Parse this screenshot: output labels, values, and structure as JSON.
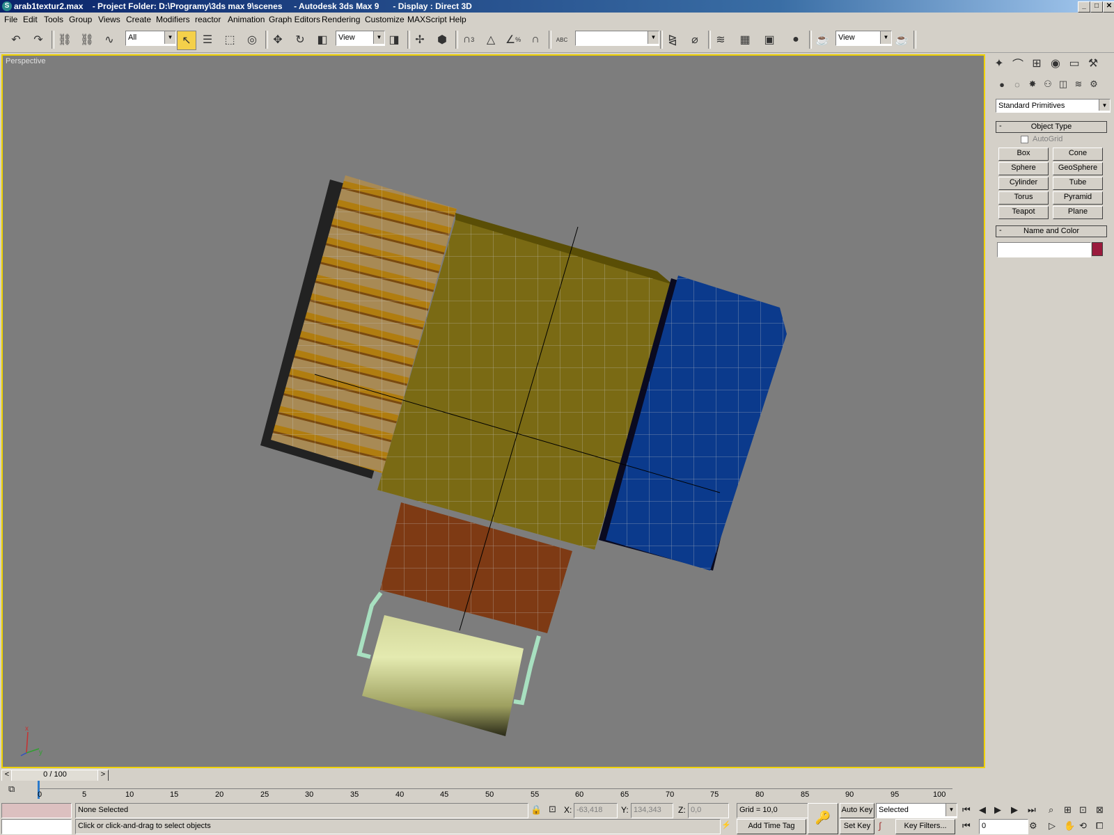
{
  "window": {
    "title": "arab1textur2.max    - Project Folder: D:\\Programy\\3ds max 9\\scenes     - Autodesk 3ds Max 9      - Display : Direct 3D",
    "logo": "S",
    "min": "_",
    "max": "□",
    "close": "✕"
  },
  "menu": [
    "File",
    "Edit",
    "Tools",
    "Group",
    "Views",
    "Create",
    "Modifiers",
    "reactor",
    "Animation",
    "Graph Editors",
    "Rendering",
    "Customize",
    "MAXScript",
    "Help"
  ],
  "toolbar": {
    "selection_filter": "All",
    "ref_coord": "View",
    "named_selection": "",
    "render_view": "View",
    "snap_3": "3",
    "snap_angle": "%",
    "mirror_abc": "ABC"
  },
  "viewport": {
    "label": "Perspective",
    "axis_x": "x",
    "axis_y": "y"
  },
  "cmd": {
    "category": "Standard Primitives",
    "object_type_title": "Object Type",
    "name_color_title": "Name and Color",
    "autogrid": "AutoGrid",
    "minus": "-",
    "buttons": [
      "Box",
      "Cone",
      "Sphere",
      "GeoSphere",
      "Cylinder",
      "Tube",
      "Torus",
      "Pyramid",
      "Teapot",
      "Plane"
    ],
    "name_value": "",
    "object_color": "#9a1a3c"
  },
  "timeline": {
    "frame_display": "0 / 100",
    "ticks": [
      "0",
      "5",
      "10",
      "15",
      "20",
      "25",
      "30",
      "35",
      "40",
      "45",
      "50",
      "55",
      "60",
      "65",
      "70",
      "75",
      "80",
      "85",
      "90",
      "95",
      "100"
    ],
    "prev": "<",
    "next": ">"
  },
  "status": {
    "selection": "None Selected",
    "prompt": "Click or click-and-drag to select objects",
    "x_label": "X:",
    "x_value": "-63,418",
    "y_label": "Y:",
    "y_value": "134,343",
    "z_label": "Z:",
    "z_value": "0,0",
    "grid": "Grid = 10,0",
    "add_time_tag": "Add Time Tag",
    "auto_key": "Auto Key",
    "set_key": "Set Key",
    "key_mode": "Selected",
    "key_filters": "Key Filters...",
    "current_frame": "0"
  },
  "colors": {
    "viewport_bg": "#7d7d7d",
    "active_border": "#f0d200",
    "title_grad_start": "#0a246a"
  }
}
